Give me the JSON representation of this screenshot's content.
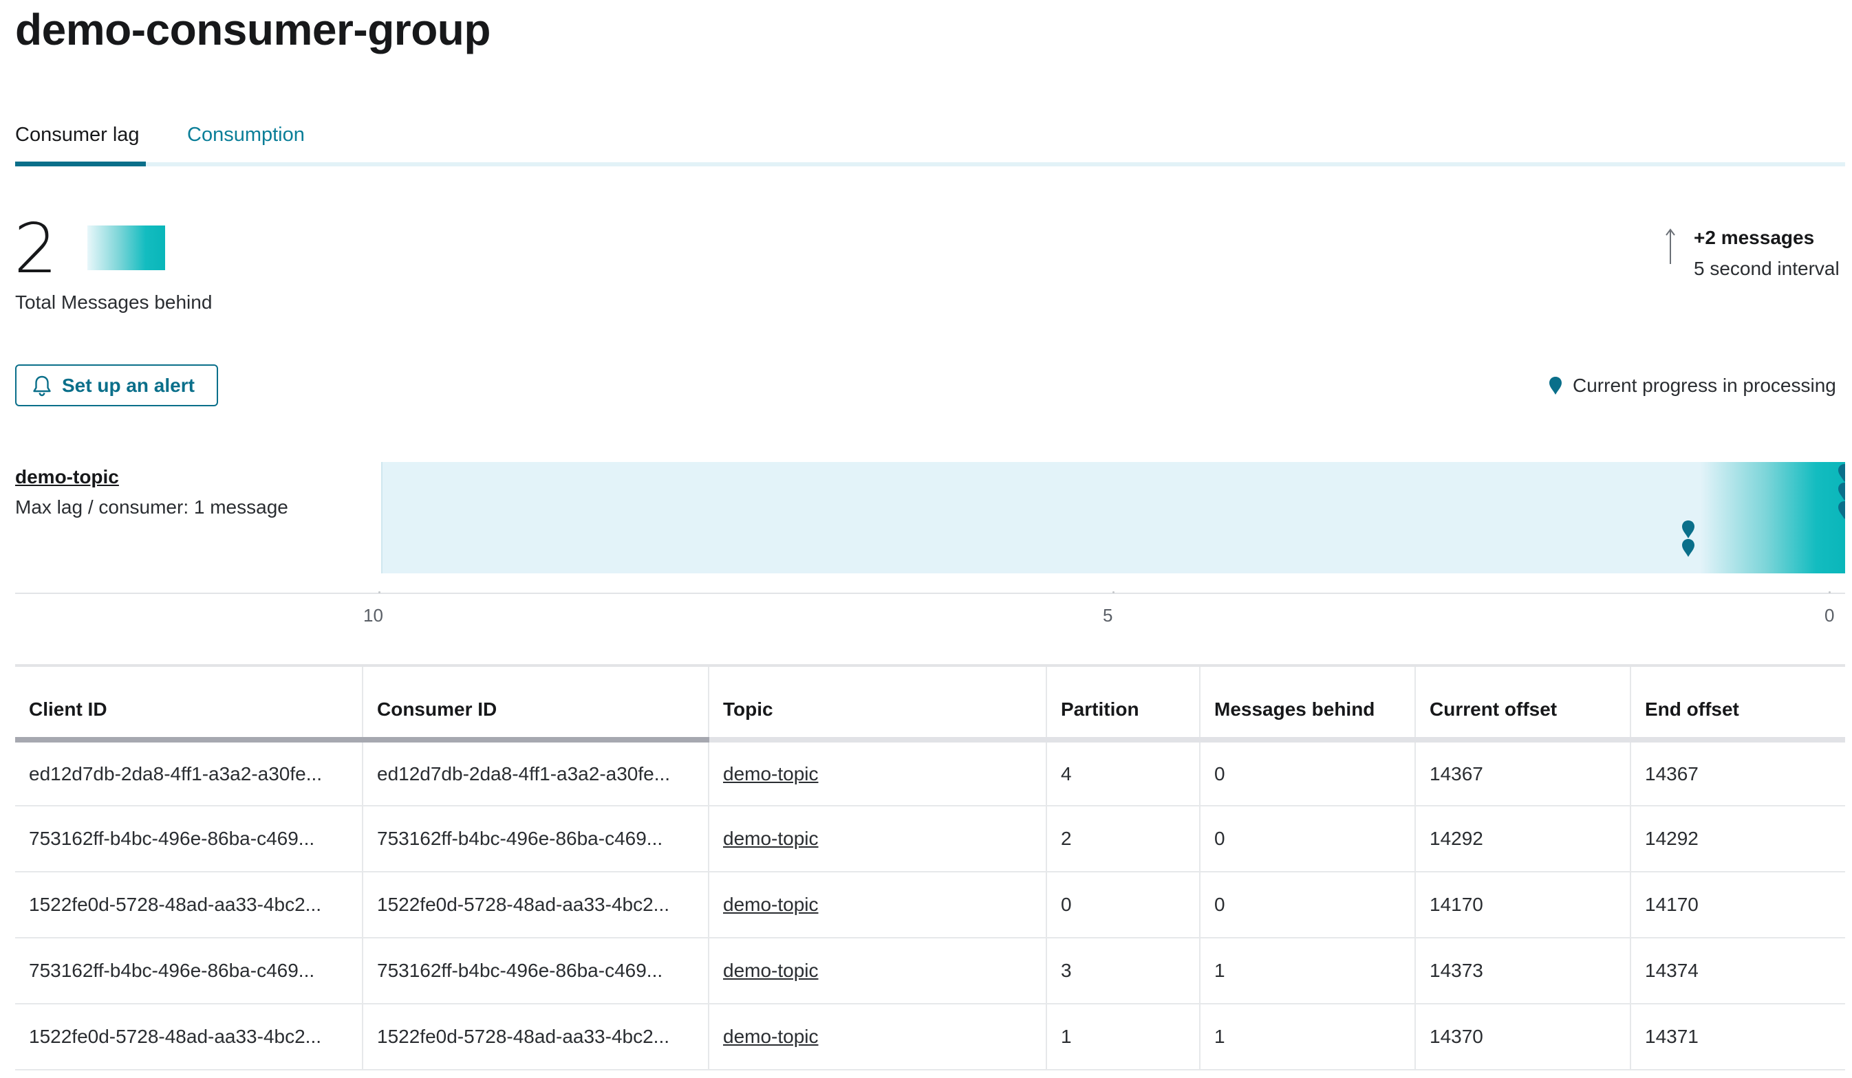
{
  "header": {
    "title": "demo-consumer-group"
  },
  "tabs": [
    {
      "label": "Consumer lag",
      "active": true
    },
    {
      "label": "Consumption",
      "active": false
    }
  ],
  "summary": {
    "total_number": "2",
    "total_label": "Total Messages behind",
    "delta_value": "+2 messages",
    "delta_interval": "5 second interval"
  },
  "alert_button": {
    "label": "Set up an alert",
    "icon": "bell-icon"
  },
  "legend": {
    "label": "Current progress in processing",
    "icon": "pin-icon"
  },
  "topic_lag": {
    "topic": "demo-topic",
    "max_lag_label": "Max lag / consumer: 1 message",
    "axis_max": 10,
    "axis_labels": [
      "10",
      "5",
      "0"
    ],
    "consumer_lags": [
      0,
      0,
      0,
      1,
      1
    ]
  },
  "table": {
    "columns": [
      "Client ID",
      "Consumer ID",
      "Topic",
      "Partition",
      "Messages behind",
      "Current offset",
      "End offset"
    ],
    "rows": [
      [
        "ed12d7db-2da8-4ff1-a3a2-a30fe...",
        "ed12d7db-2da8-4ff1-a3a2-a30fe...",
        "demo-topic",
        "4",
        "0",
        "14367",
        "14367"
      ],
      [
        "753162ff-b4bc-496e-86ba-c469...",
        "753162ff-b4bc-496e-86ba-c469...",
        "demo-topic",
        "2",
        "0",
        "14292",
        "14292"
      ],
      [
        "1522fe0d-5728-48ad-aa33-4bc2...",
        "1522fe0d-5728-48ad-aa33-4bc2...",
        "demo-topic",
        "0",
        "0",
        "14170",
        "14170"
      ],
      [
        "753162ff-b4bc-496e-86ba-c469...",
        "753162ff-b4bc-496e-86ba-c469...",
        "demo-topic",
        "3",
        "1",
        "14373",
        "14374"
      ],
      [
        "1522fe0d-5728-48ad-aa33-4bc2...",
        "1522fe0d-5728-48ad-aa33-4bc2...",
        "demo-topic",
        "1",
        "1",
        "14370",
        "14371"
      ]
    ]
  },
  "colors": {
    "accent": "#0a6f8a",
    "link_tab": "#0a7e98",
    "bar_bg": "#e3f3f9",
    "lag_fill": "#0ab6ba"
  }
}
